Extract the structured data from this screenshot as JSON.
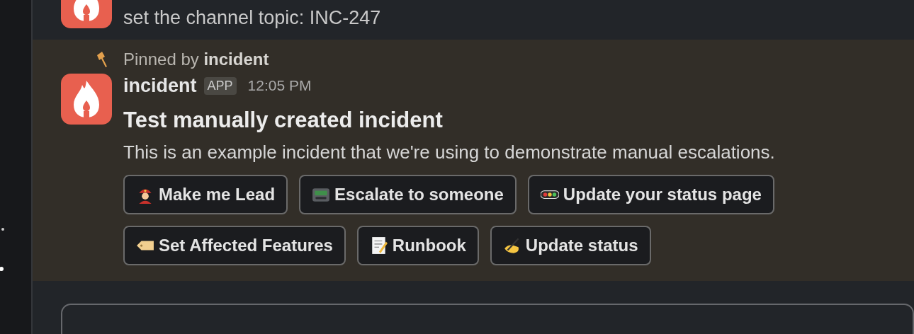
{
  "previous_message": {
    "text": "set the channel topic: INC-247"
  },
  "pinned_message": {
    "pinned_by": "Pinned by **incident**",
    "author": "incident",
    "badge": "APP",
    "time": "12:05 PM",
    "title": "Test manually created incident",
    "body": "This is an example incident that we're using to demonstrate manual escalations.",
    "button_rows": [
      [
        "Make me Lead",
        "Escalate to someone",
        "Update your status page"
      ],
      [
        "Set Affected Features",
        "Runbook",
        "Update status"
      ]
    ]
  }
}
